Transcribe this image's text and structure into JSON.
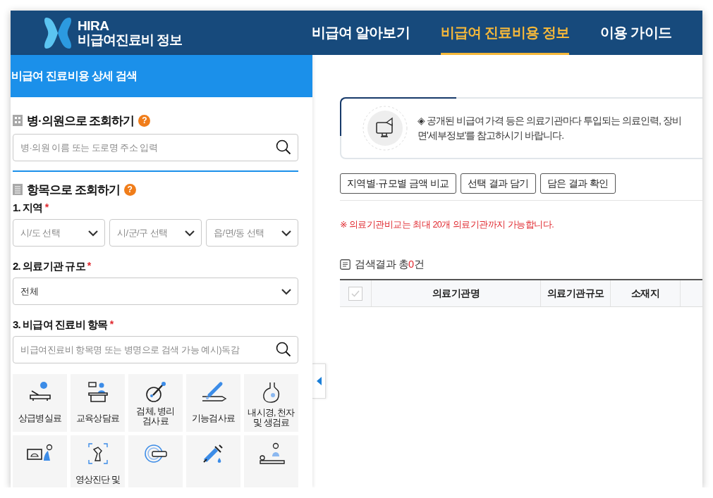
{
  "header": {
    "logo_title": "HIRA",
    "logo_subtitle": "비급여진료비 정보",
    "nav": [
      {
        "label": "비급여 알아보기",
        "selected": false
      },
      {
        "label": "비급여 진료비용 정보",
        "selected": true
      },
      {
        "label": "이용 가이드",
        "selected": false
      }
    ]
  },
  "sidebar": {
    "title": "비급여 진료비용 상세 검색",
    "hospital_search": {
      "heading": "병·의원으로 조회하기",
      "help": "?",
      "placeholder": "병·의원 이름 또는 도로명 주소 입력"
    },
    "item_search": {
      "heading": "항목으로 조회하기",
      "help": "?",
      "region": {
        "label": "1. 지역",
        "mark": "*",
        "selects": [
          "시/도 선택",
          "시/군/구 선택",
          "읍/면/동 선택"
        ]
      },
      "scale": {
        "label": "2. 의료기관 규모",
        "mark": "*",
        "value": "전체"
      },
      "items": {
        "label": "3. 비급여 진료비 항목",
        "mark": "*",
        "placeholder": "비급여진료비 항목명 또는 병명으로 검색 가능 예시)독감",
        "tiles": [
          {
            "kind": "labeled",
            "lines": [
              "상급병실료"
            ]
          },
          {
            "kind": "labeled",
            "lines": [
              "교육상담료"
            ]
          },
          {
            "kind": "labeled",
            "lines": [
              "검체, 병리",
              "검사료"
            ]
          },
          {
            "kind": "labeled",
            "lines": [
              "기능검사료"
            ]
          },
          {
            "kind": "labeled",
            "lines": [
              "내시경, 천자",
              "및 생검료"
            ]
          },
          {
            "kind": "cut"
          },
          {
            "kind": "labeled",
            "lines": [
              "영상진단 및"
            ]
          },
          {
            "kind": "cut"
          },
          {
            "kind": "cut"
          },
          {
            "kind": "cut"
          }
        ]
      }
    }
  },
  "main": {
    "notice": [
      "◈ 공개된 비급여 가격 등은 의료기관마다 투입되는 의료인력, 장비",
      "면'세부정보'를 참고하시기 바랍니다."
    ],
    "buttons": [
      "지역별·규모별 금액 비교",
      "선택 결과 담기",
      "담은 결과 확인"
    ],
    "note": "※ 의료기관비교는 최대 20개 의료기관까지 가능합니다.",
    "result": {
      "prefix": "검색결과 총",
      "count": "0",
      "suffix": "건"
    },
    "table": {
      "select_all_checked": false,
      "columns": [
        "의료기관명",
        "의료기관규모",
        "소재지"
      ]
    }
  }
}
